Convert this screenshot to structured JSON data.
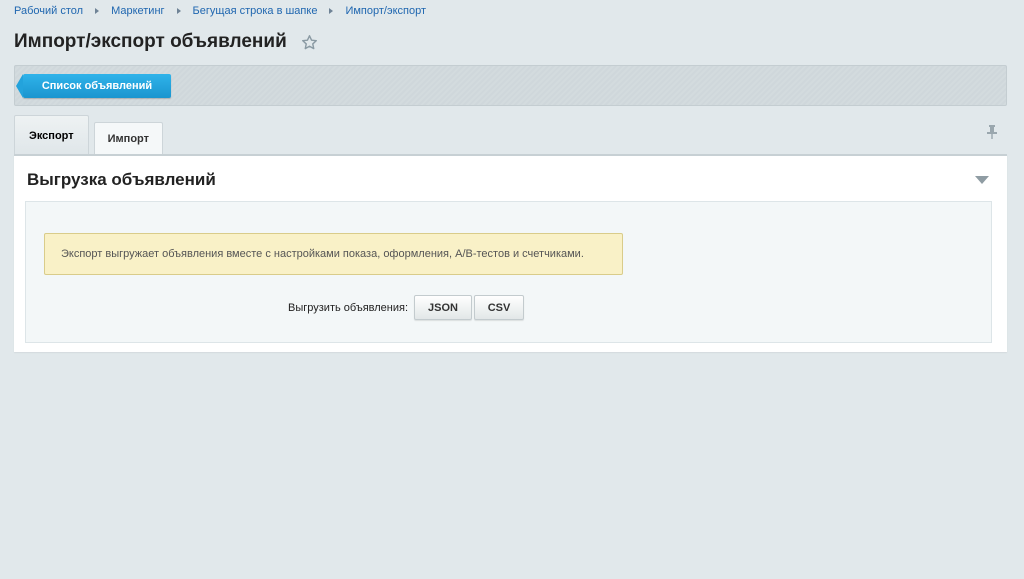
{
  "breadcrumb": {
    "items": [
      "Рабочий стол",
      "Маркетинг",
      "Бегущая строка в шапке",
      "Импорт/экспорт"
    ]
  },
  "page": {
    "title": "Импорт/экспорт объявлений"
  },
  "toolbar": {
    "list_button_label": "Список объявлений"
  },
  "tabs": [
    {
      "label": "Экспорт",
      "active": true
    },
    {
      "label": "Импорт",
      "active": false
    }
  ],
  "section": {
    "title": "Выгрузка объявлений",
    "notice": "Экспорт выгружает объявления вместе с настройками показа, оформления, A/B-тестов и счетчиками.",
    "export_label": "Выгрузить объявления:",
    "json_button": "JSON",
    "csv_button": "CSV"
  },
  "colors": {
    "accent": "#1a95cf",
    "link": "#2067b0",
    "notice_bg": "#f9f1c7",
    "background": "#e1e8eb"
  },
  "icons": {
    "favorite": "star-icon",
    "pin": "pin-icon",
    "collapse": "triangle-down-icon"
  }
}
